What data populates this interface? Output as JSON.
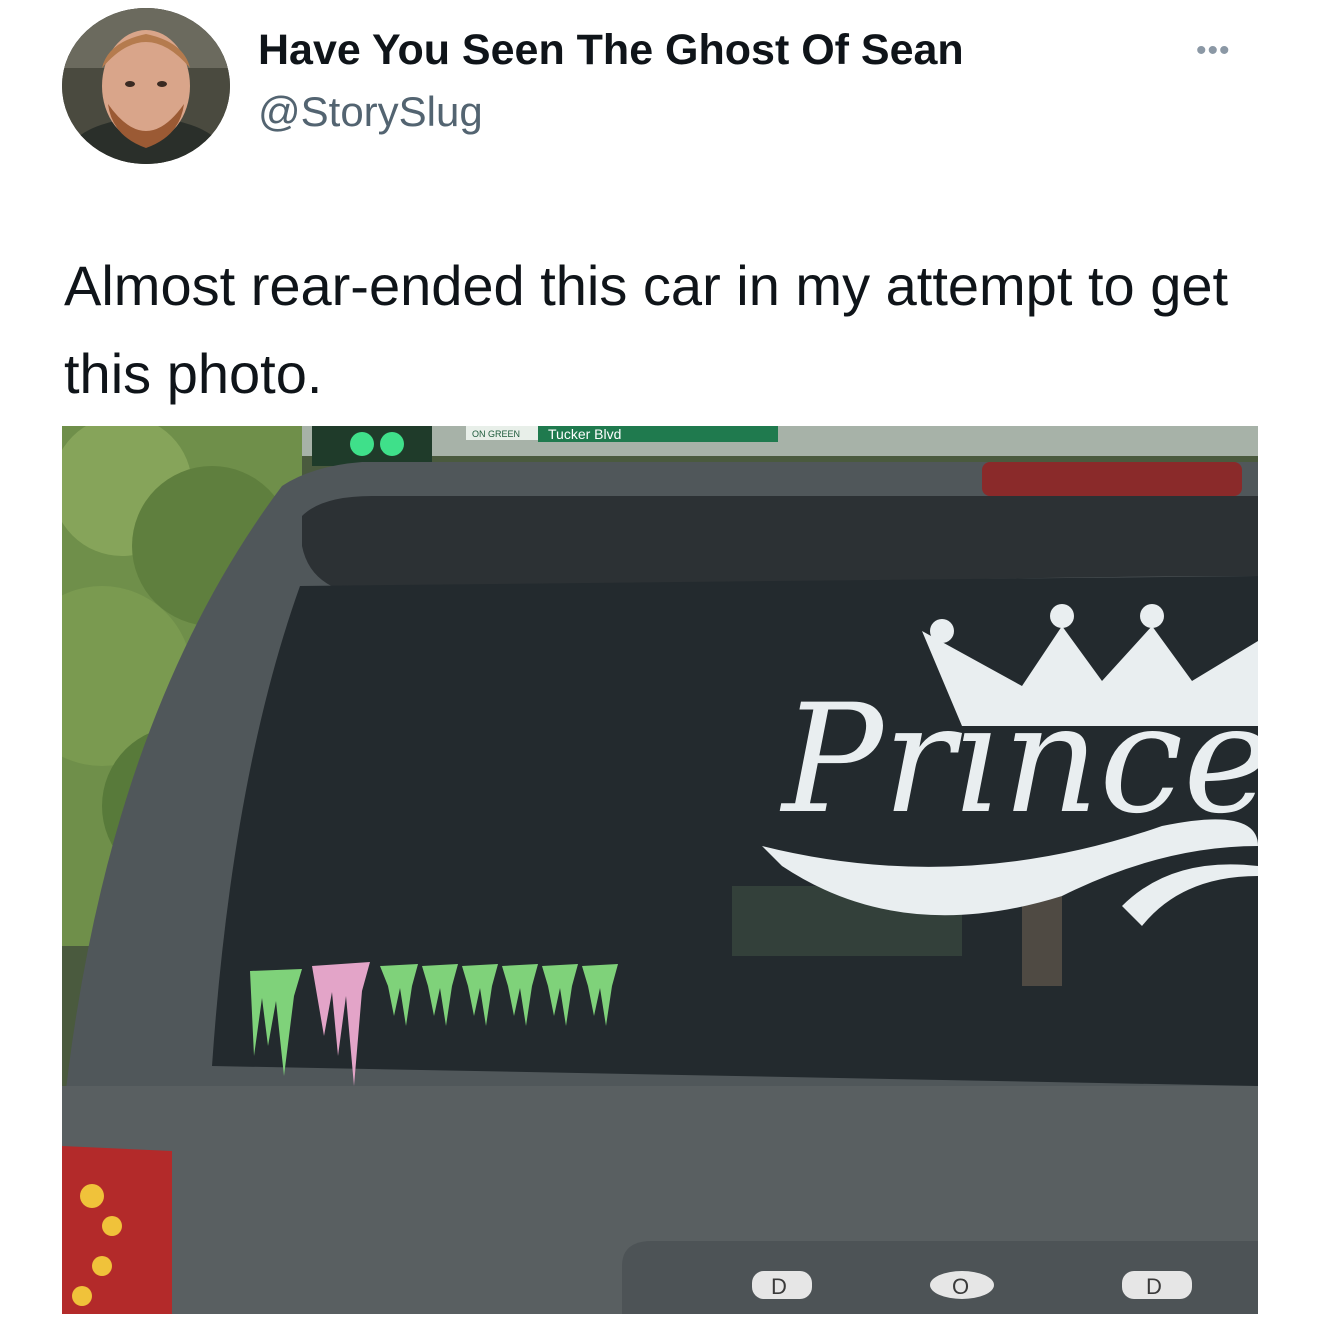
{
  "tweet": {
    "author": {
      "display_name": "Have You Seen The Ghost Of Sean",
      "handle": "@StorySlug",
      "avatar_icon": "person-avatar"
    },
    "more_icon": "ellipsis-icon",
    "more_label": "•••",
    "text": "Almost rear-ended this car in my attempt to get this photo.",
    "photo": {
      "street_sign": "Tucker Blvd",
      "sign_small": "ON GREEN",
      "window_decal": "Prince",
      "badge_letters": [
        "D",
        "O",
        "D"
      ],
      "accent_colors": {
        "decal_white": "#e9eef0",
        "claw_green": "#7fd27a",
        "claw_pink": "#e3a4c8",
        "glass": "#232a2e",
        "body": "#555a5c"
      }
    }
  }
}
